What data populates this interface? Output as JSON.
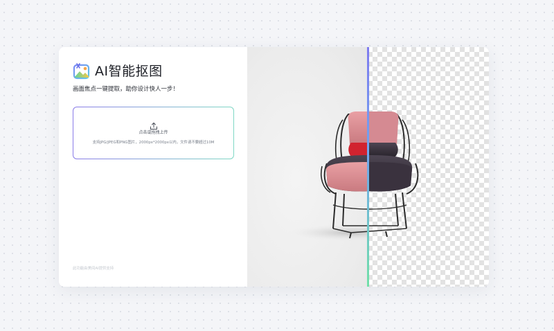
{
  "app": {
    "title": "AI智能抠图",
    "subtitle": "画面焦点一键提取，助你设计快人一步！",
    "logo_icon": "image-cutout-logo-icon"
  },
  "upload": {
    "icon": "upload-icon",
    "label": "点击或拖拽上传",
    "hint": "支持JPG/JPEG和PNG图片，2000px*2000px以内，文件请不要超过10M"
  },
  "footer": {
    "text": "此功能由美间AI提供支持"
  },
  "colors": {
    "accent_start": "#8a7be8",
    "accent_end": "#7fd8c4",
    "divider_top": "#7f7bf0",
    "divider_bottom": "#71e0a8"
  }
}
